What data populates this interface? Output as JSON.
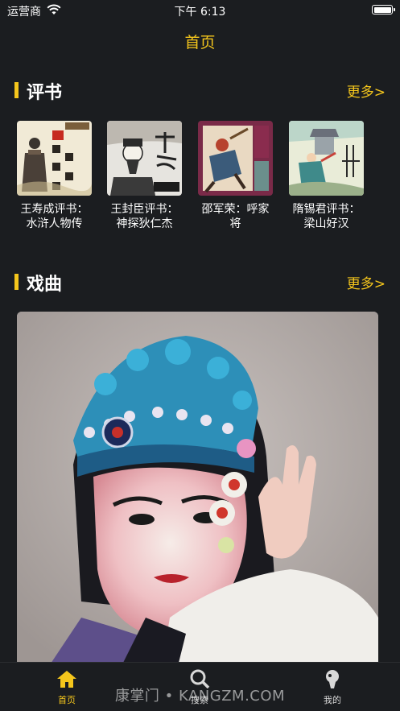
{
  "status_bar": {
    "carrier": "运营商",
    "time": "下午 6:13"
  },
  "nav": {
    "title": "首页"
  },
  "pingshu": {
    "title": "评书",
    "more": "更多>",
    "books": [
      {
        "name": "王寿成评书：水浒人物传"
      },
      {
        "name": "王封臣评书：神探狄仁杰"
      },
      {
        "name": "邵军荣：呼家将"
      },
      {
        "name": "隋锡君评书：梁山好汉"
      }
    ]
  },
  "xiqu": {
    "title": "戏曲",
    "more": "更多>"
  },
  "tabs": [
    {
      "label": "首页",
      "icon": "home-icon",
      "active": true
    },
    {
      "label": "搜索",
      "icon": "search-icon",
      "active": false
    },
    {
      "label": "我的",
      "icon": "profile-icon",
      "active": false
    }
  ],
  "watermark": "康掌门 • KANGZM.COM",
  "colors": {
    "accent": "#f5c61c",
    "background": "#1b1d20"
  }
}
